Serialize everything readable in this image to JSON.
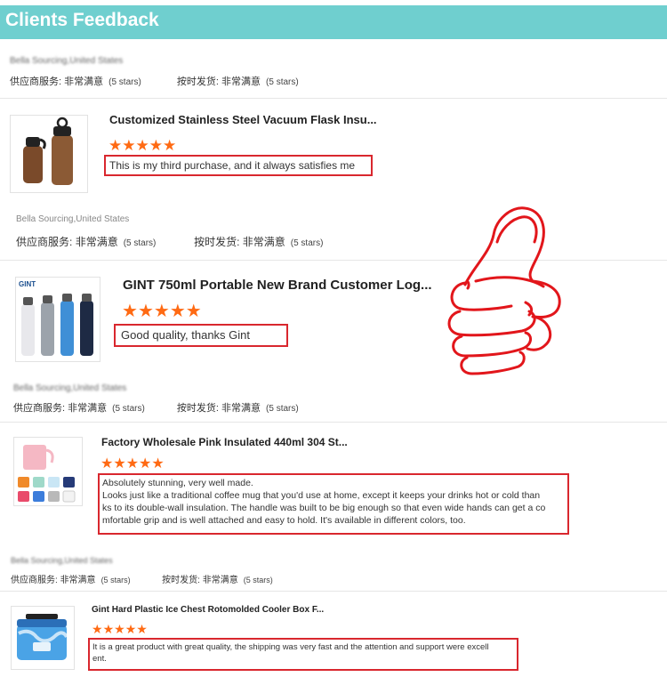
{
  "header": {
    "title": "Clients Feedback"
  },
  "labels": {
    "supplier_service": "供应商服务:",
    "on_time_shipment": "按时发货:",
    "very_satisfied": "非常满意",
    "stars5": "(5 stars)"
  },
  "reviews": [
    {
      "buyer": "Bella Sourcing,United States",
      "product": "Customized Stainless Steel Vacuum Flask Insu...",
      "rating": 5,
      "text": "This is my third purchase, and it always satisfies me"
    },
    {
      "buyer": "Bella Sourcing,United States",
      "product": "GINT 750ml Portable New Brand Customer Log...",
      "rating": 5,
      "thumb_brand": "GINT",
      "text": "Good quality, thanks Gint"
    },
    {
      "buyer": "Bella Sourcing,United States",
      "product": "Factory Wholesale Pink Insulated 440ml 304 St...",
      "rating": 5,
      "text_lines": [
        "Absolutely stunning, very well made.",
        "Looks just like a traditional coffee mug that you'd use at home, except it keeps your drinks hot or cold than",
        "ks to its double-wall insulation. The handle was built to be big enough so that even wide hands can get a co",
        "mfortable grip and is well attached and easy to hold. It's available in different colors, too."
      ]
    },
    {
      "buyer": "Bella Sourcing,United States",
      "product": "Gint Hard Plastic Ice Chest Rotomolded Cooler Box F...",
      "rating": 5,
      "text_lines": [
        "It is a great product with great quality, the shipping was very fast and the attention and support were excell",
        "ent."
      ]
    }
  ],
  "colors": {
    "header": "#6fcfcf",
    "star": "#ff6a13",
    "highlight": "#d9272e"
  },
  "icons": {
    "thumbs_up": "thumbs-up-icon"
  }
}
